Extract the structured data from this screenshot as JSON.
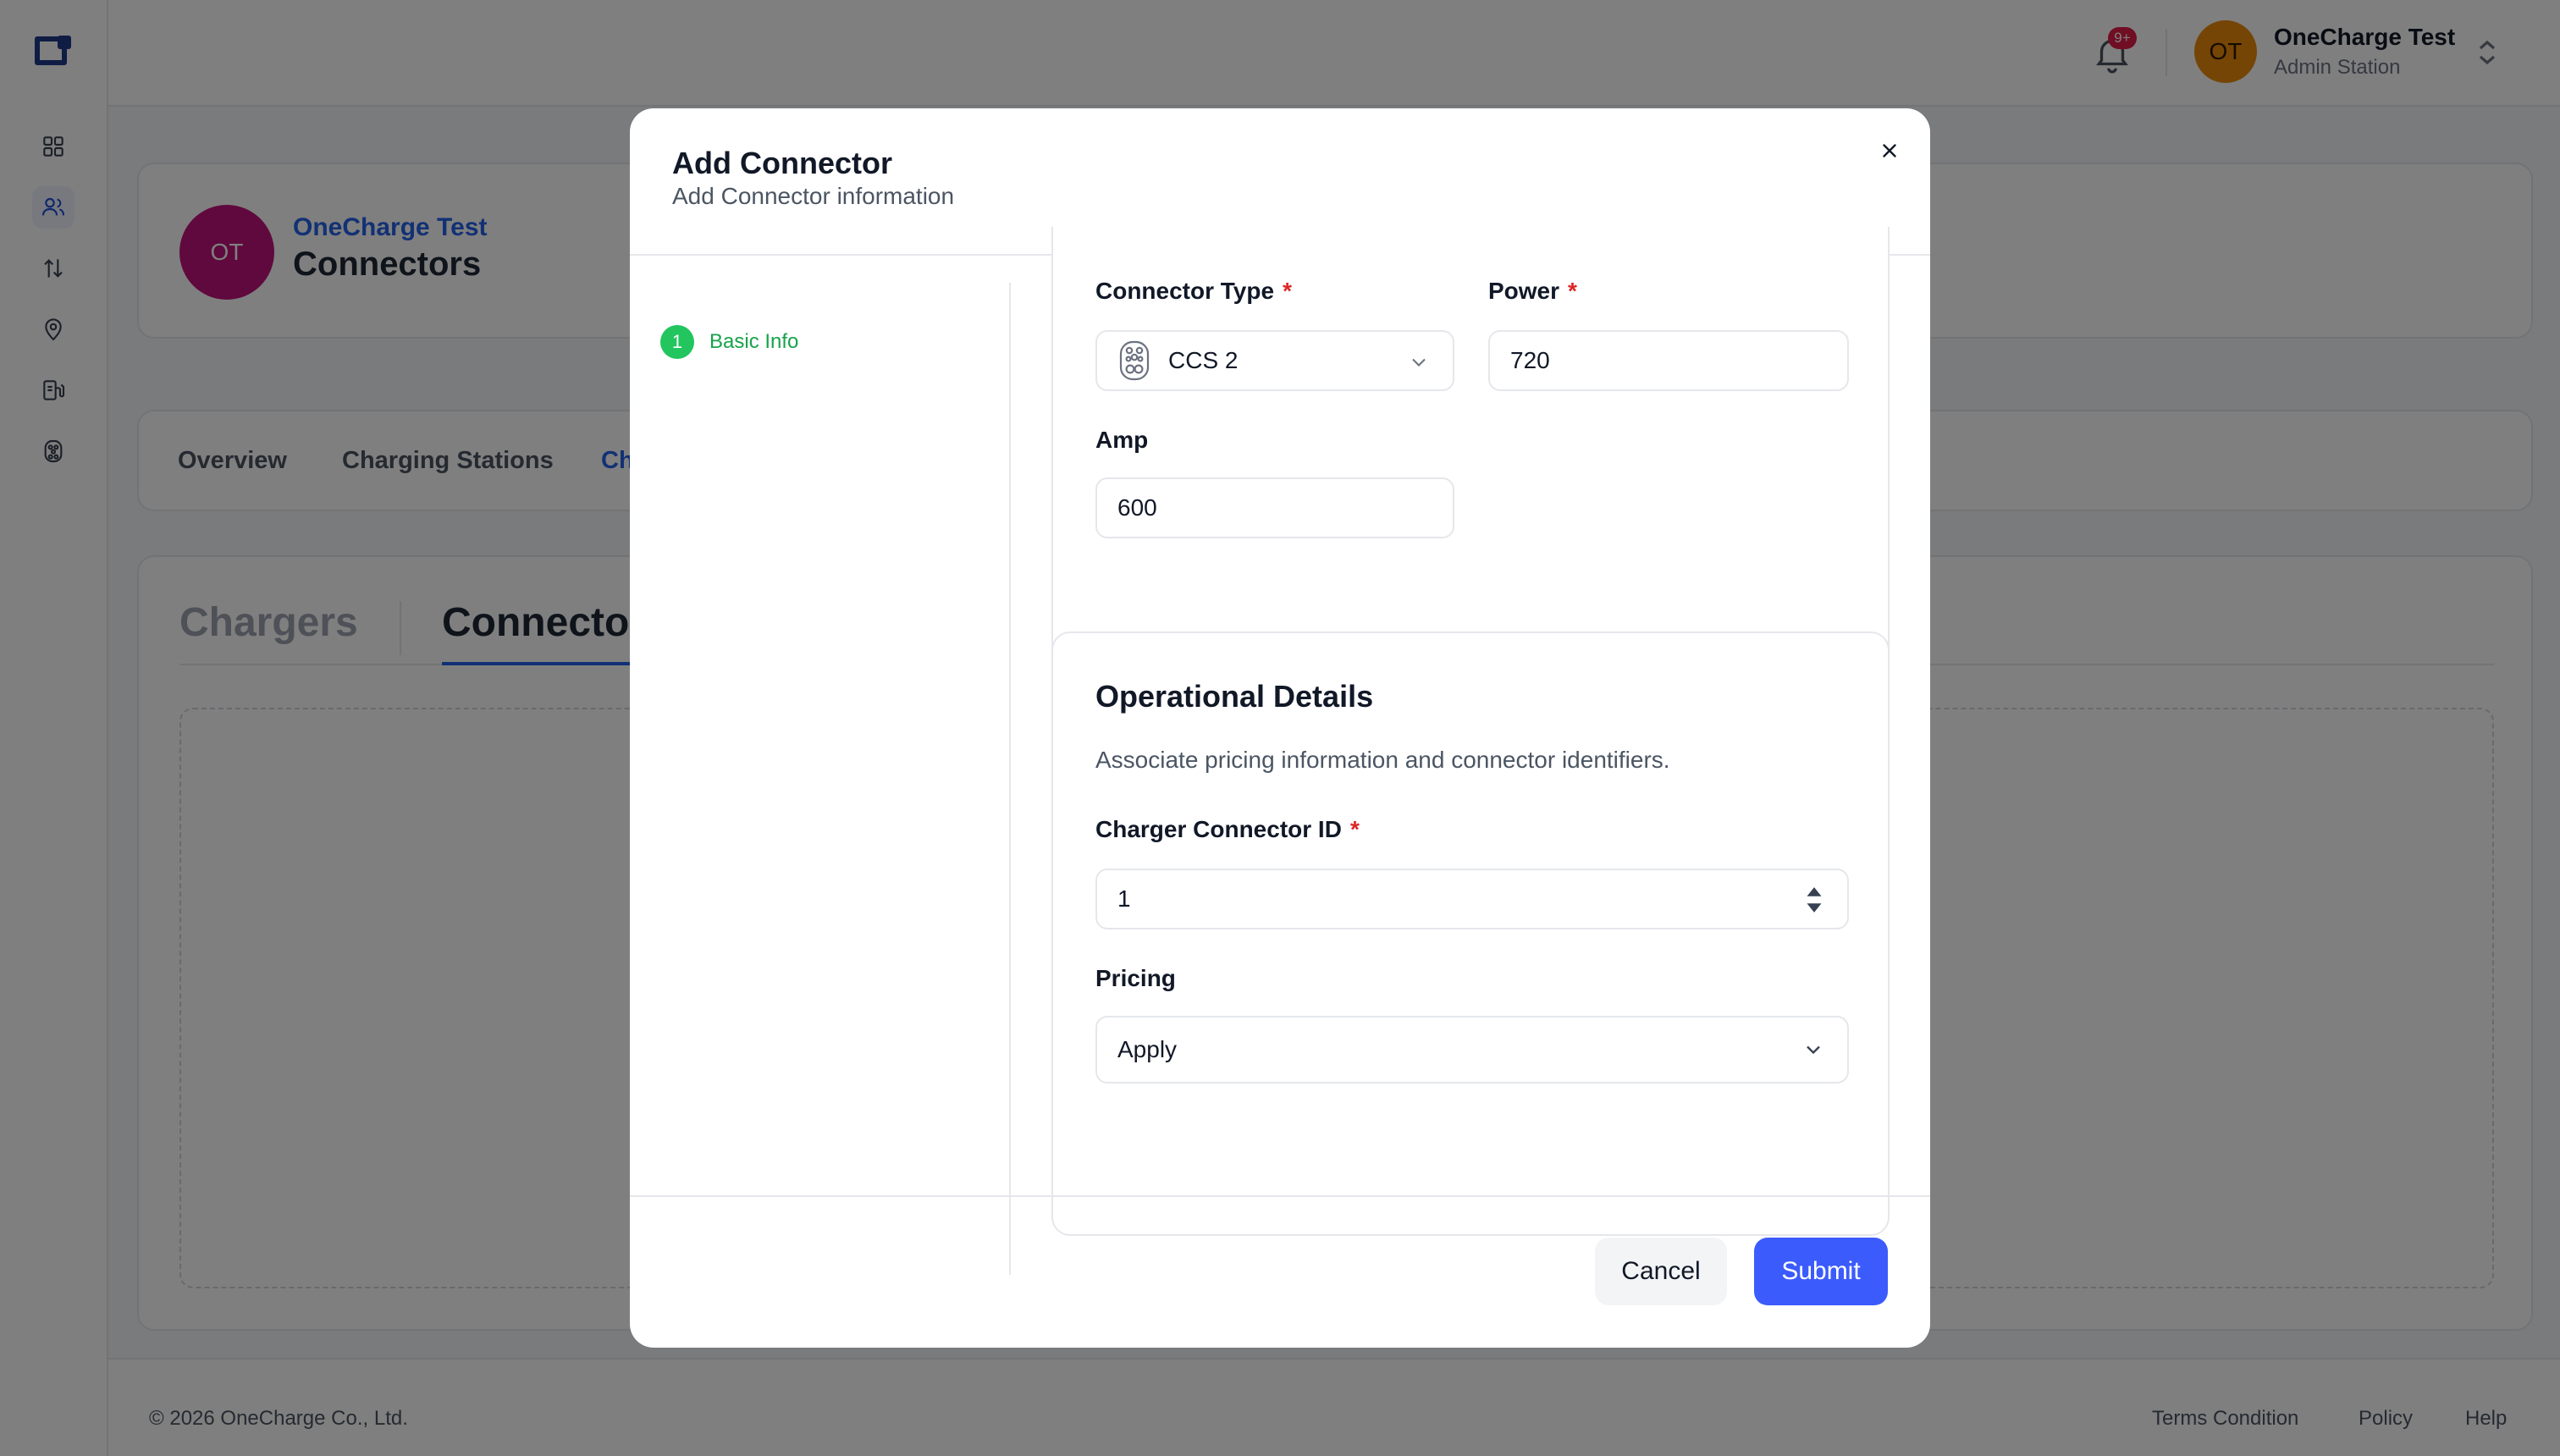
{
  "topbar": {
    "notification_badge": "9+",
    "user_initials": "OT",
    "user_name": "OneCharge Test",
    "user_role": "Admin Station"
  },
  "header": {
    "avatar_initials": "OT",
    "org_name": "OneCharge Test",
    "page_title": "Connectors"
  },
  "tabs": [
    "Overview",
    "Charging Stations",
    "Ch"
  ],
  "subtabs": {
    "chargers": "Chargers",
    "connectors": "Connecto"
  },
  "footer": {
    "copyright": "© 2026 OneCharge Co., Ltd.",
    "links": [
      "Terms Condition",
      "Policy",
      "Help"
    ]
  },
  "modal": {
    "title": "Add Connector",
    "subtitle": "Add Connector information",
    "steps": [
      {
        "number": "1",
        "label": "Basic Info"
      }
    ],
    "fields": {
      "connector_type": {
        "label": "Connector Type",
        "required_mark": "*",
        "value": "CCS 2"
      },
      "power": {
        "label": "Power",
        "required_mark": "*",
        "value": "720"
      },
      "amp": {
        "label": "Amp",
        "value": "600"
      },
      "charger_connector_id": {
        "label": "Charger Connector ID",
        "required_mark": "*",
        "value": "1"
      },
      "pricing": {
        "label": "Pricing",
        "value": "Apply"
      }
    },
    "operational": {
      "title": "Operational Details",
      "description": "Associate pricing information and connector identifiers."
    },
    "buttons": {
      "cancel": "Cancel",
      "submit": "Submit"
    }
  },
  "colors": {
    "accent": "#3b5bfd",
    "link": "#2563eb",
    "step_done": "#22c55e",
    "required": "#dc2626",
    "user_avatar": "#ea8a0c",
    "org_avatar": "#c0127d"
  },
  "icons": {
    "sidebar": [
      "logo-icon",
      "dashboard-icon",
      "users-icon",
      "transfer-icon",
      "location-icon",
      "charger-station-icon",
      "connector-icon"
    ],
    "topbar": [
      "bell-icon",
      "chevron-updown-icon"
    ],
    "modal": [
      "close-icon",
      "ccs2-connector-icon",
      "chevron-down-icon",
      "number-stepper-icon"
    ]
  }
}
